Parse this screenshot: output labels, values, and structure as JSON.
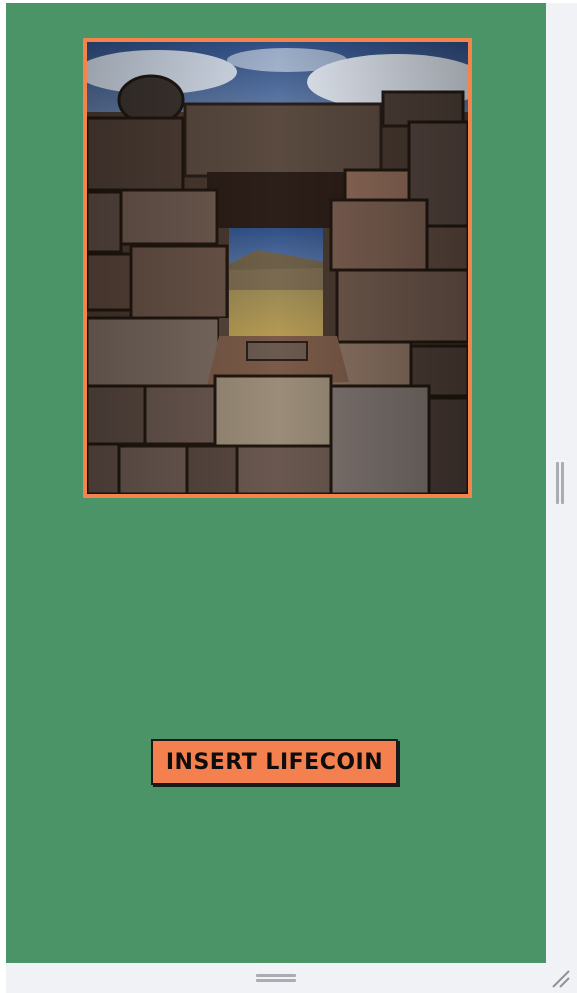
{
  "page": {
    "background": "#f1f2f5",
    "stage_color": "#4a9468",
    "accent": "#f5844c"
  },
  "photo": {
    "subject": "stone-ruin-window"
  },
  "action_button": {
    "label": "INSERT LIFECOIN",
    "color": "#f5804f"
  },
  "icons": {
    "vertical_splitter": "drag-handle-vertical-icon",
    "horizontal_splitter": "drag-handle-horizontal-icon",
    "resize": "resize-corner-icon"
  }
}
